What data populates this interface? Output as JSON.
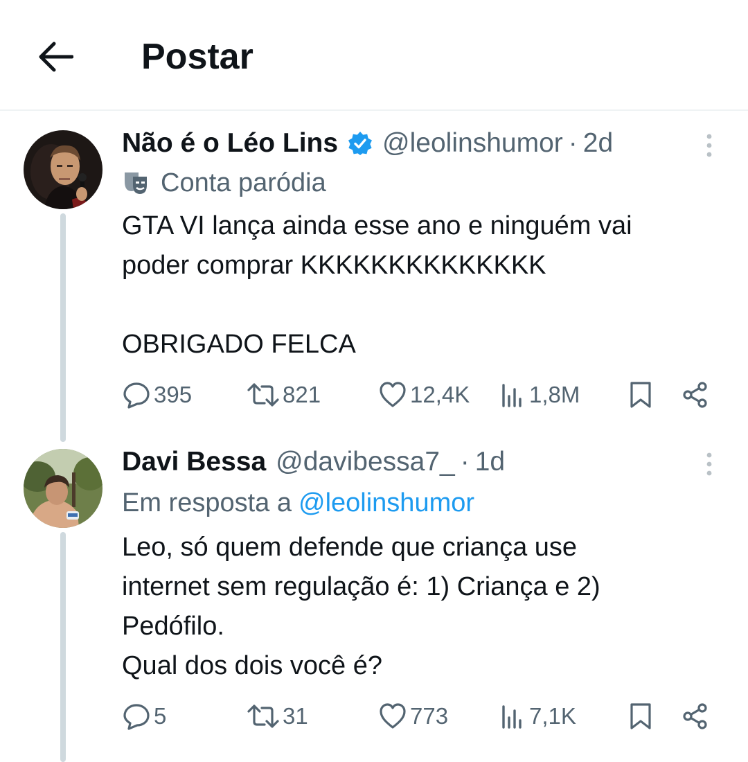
{
  "header": {
    "title": "Postar"
  },
  "tweets": [
    {
      "display_name": "Não é o Léo Lins",
      "handle": "@leolinshumor",
      "separator": "·",
      "time": "2d",
      "label": "Conta paródia",
      "lines": [
        "GTA VI lança ainda esse ano e ninguém vai",
        "poder comprar KKKKKKKKKKKKKK",
        "",
        "OBRIGADO FELCA"
      ],
      "stats": {
        "replies": "395",
        "reposts": "821",
        "likes": "12,4K",
        "views": "1,8M"
      }
    },
    {
      "display_name": "Davi Bessa",
      "handle": "@davibessa7_",
      "separator": "·",
      "time": "1d",
      "reply_prefix": "Em resposta a",
      "reply_to": "@leolinshumor",
      "lines": [
        "Leo, só quem defende que criança use",
        "internet sem regulação é: 1) Criança e 2)",
        "Pedófilo.",
        "Qual dos dois você é?"
      ],
      "stats": {
        "replies": "5",
        "reposts": "31",
        "likes": "773",
        "views": "7,1K"
      }
    }
  ],
  "colors": {
    "text": "#0f1419",
    "secondary": "#536471",
    "link": "#1d9bf0",
    "verified": "#1d9bf0",
    "border": "#eff3f4"
  }
}
